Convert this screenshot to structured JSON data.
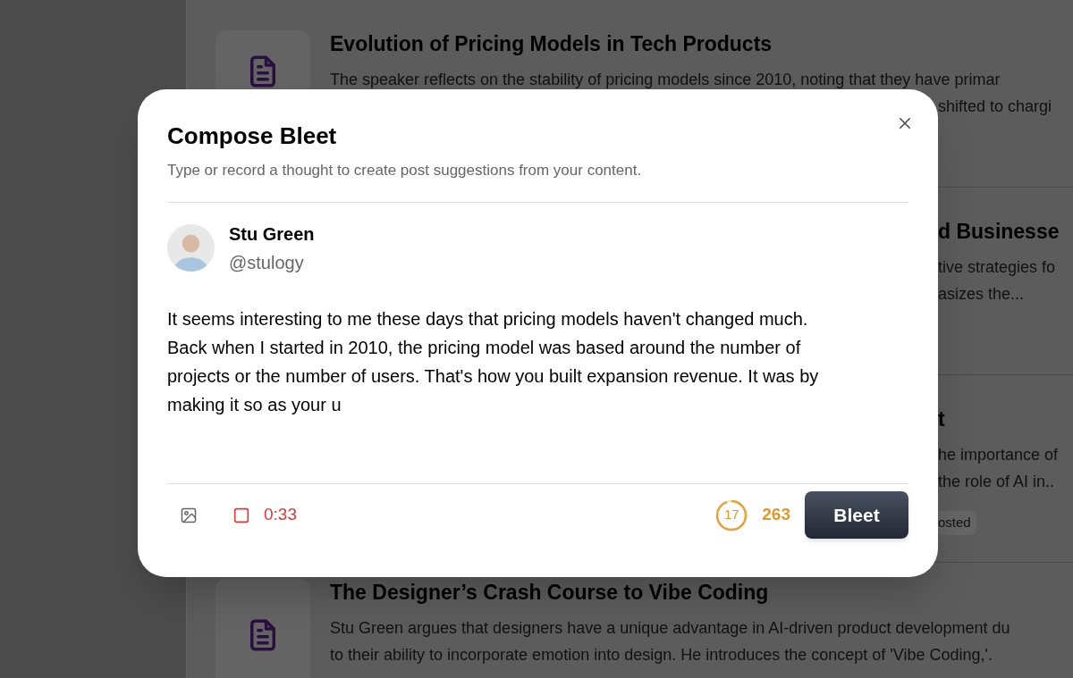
{
  "background_cards": [
    {
      "title": "Evolution of Pricing Models in Tech Products",
      "description_lines": [
        "The speaker reflects on the stability of pricing models since 2010, noting that they have primar"
      ],
      "right_fragments": [
        "shifted to chargi"
      ],
      "icon_visible": true
    },
    {
      "right_title": "d Businesse",
      "right_fragments": [
        "tive strategies fo",
        "asizes the..."
      ],
      "icon_visible": false
    },
    {
      "right_title": "t",
      "right_fragments": [
        "he importance of",
        "the role of AI in.."
      ],
      "icon_visible": false,
      "tag": "osted"
    },
    {
      "title": "The Designer’s Crash Course to Vibe Coding",
      "description_lines": [
        "Stu Green argues that designers have a unique advantage in AI-driven product development du",
        "to their ability to incorporate emotion into design. He introduces the concept of 'Vibe Coding,'."
      ],
      "icon_visible": true
    }
  ],
  "dialog": {
    "title": "Compose Bleet",
    "subtitle": "Type or record a thought to create post suggestions from your content.",
    "author": {
      "name": "Stu Green",
      "handle": "@stulogy"
    },
    "text": "It seems interesting to me these days that pricing models haven't changed much. Back when I started in 2010, the pricing model was based around the number of projects or the number of users. That's how you built expansion revenue. It was by making it so as your u",
    "recording": true,
    "timer": "0:33",
    "counter": {
      "remaining": "17",
      "count": "263"
    },
    "submit": "Bleet"
  }
}
